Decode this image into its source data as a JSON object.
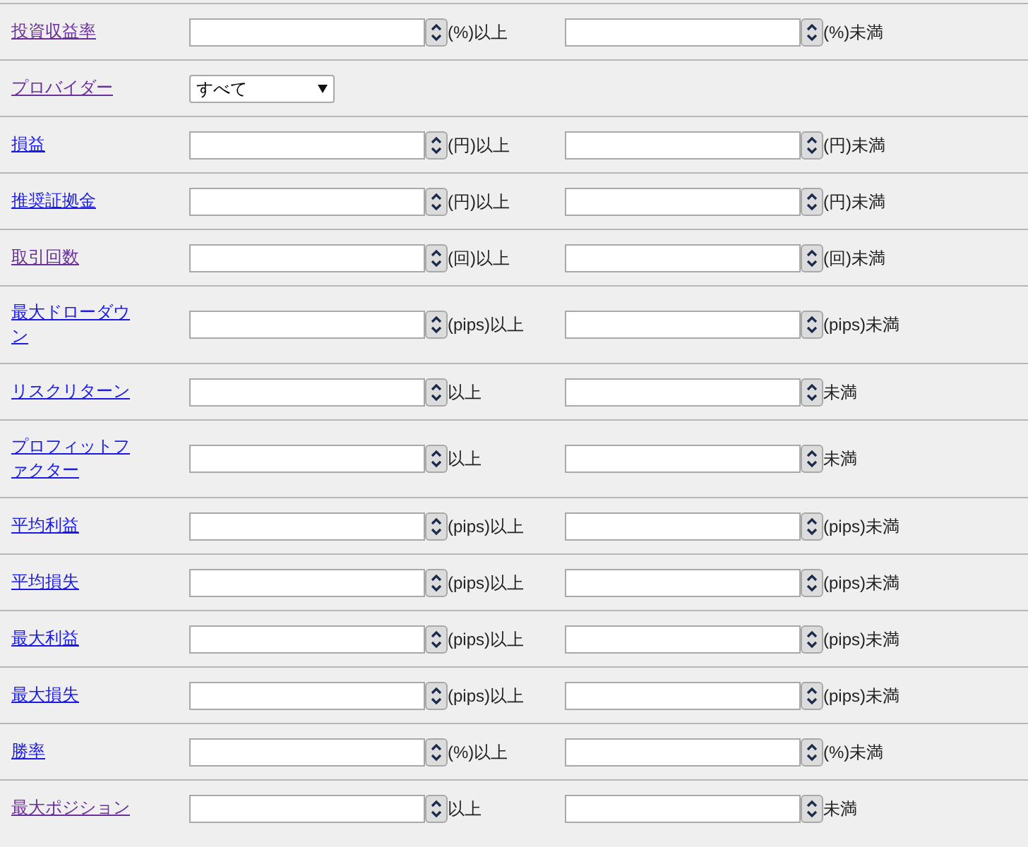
{
  "rows": [
    {
      "kind": "range",
      "label": "投資収益率",
      "visited": true,
      "min_suffix": "(%)以上",
      "max_suffix": "(%)未満"
    },
    {
      "kind": "select",
      "label": "プロバイダー",
      "visited": true,
      "value": "すべて"
    },
    {
      "kind": "range",
      "label": "損益",
      "visited": false,
      "min_suffix": "(円)以上",
      "max_suffix": "(円)未満"
    },
    {
      "kind": "range",
      "label": "推奨証拠金",
      "visited": false,
      "min_suffix": "(円)以上",
      "max_suffix": "(円)未満"
    },
    {
      "kind": "range",
      "label": "取引回数",
      "visited": true,
      "min_suffix": "(回)以上",
      "max_suffix": "(回)未満"
    },
    {
      "kind": "range",
      "label": "最大ドローダウン",
      "visited": false,
      "min_suffix": "(pips)以上",
      "max_suffix": "(pips)未満"
    },
    {
      "kind": "range",
      "label": "リスクリターン",
      "visited": false,
      "min_suffix": "以上",
      "max_suffix": "未満"
    },
    {
      "kind": "range",
      "label": "プロフィットファクター",
      "visited": false,
      "min_suffix": "以上",
      "max_suffix": "未満"
    },
    {
      "kind": "range",
      "label": "平均利益",
      "visited": false,
      "min_suffix": "(pips)以上",
      "max_suffix": "(pips)未満"
    },
    {
      "kind": "range",
      "label": "平均損失",
      "visited": false,
      "min_suffix": "(pips)以上",
      "max_suffix": "(pips)未満"
    },
    {
      "kind": "range",
      "label": "最大利益",
      "visited": false,
      "min_suffix": "(pips)以上",
      "max_suffix": "(pips)未満"
    },
    {
      "kind": "range",
      "label": "最大損失",
      "visited": false,
      "min_suffix": "(pips)以上",
      "max_suffix": "(pips)未満"
    },
    {
      "kind": "range",
      "label": "勝率",
      "visited": false,
      "min_suffix": "(%)以上",
      "max_suffix": "(%)未満"
    },
    {
      "kind": "range",
      "label": "最大ポジション",
      "visited": true,
      "min_suffix": "以上",
      "max_suffix": "未満"
    }
  ]
}
